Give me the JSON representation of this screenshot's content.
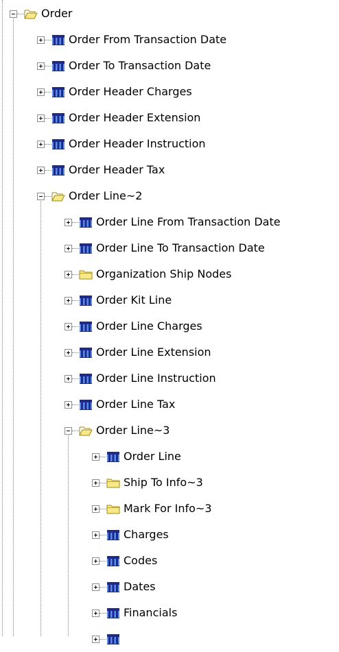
{
  "tree": {
    "root": {
      "label": "Order",
      "icon": "folder-open-icon",
      "expanded": true
    },
    "level1": [
      {
        "label": "Order From Transaction Date",
        "icon": "table-icon",
        "expanded": false
      },
      {
        "label": "Order To Transaction Date",
        "icon": "table-icon",
        "expanded": false
      },
      {
        "label": "Order Header Charges",
        "icon": "table-icon",
        "expanded": false
      },
      {
        "label": "Order Header Extension",
        "icon": "table-icon",
        "expanded": false
      },
      {
        "label": "Order Header Instruction",
        "icon": "table-icon",
        "expanded": false
      },
      {
        "label": "Order Header Tax",
        "icon": "table-icon",
        "expanded": false
      },
      {
        "label": "Order Line~2",
        "icon": "folder-open-icon",
        "expanded": true
      }
    ],
    "level2": [
      {
        "label": "Order Line From Transaction Date",
        "icon": "table-icon",
        "expanded": false
      },
      {
        "label": "Order Line To Transaction Date",
        "icon": "table-icon",
        "expanded": false
      },
      {
        "label": "Organization Ship Nodes",
        "icon": "folder-closed-icon",
        "expanded": false
      },
      {
        "label": "Order Kit Line",
        "icon": "table-icon",
        "expanded": false
      },
      {
        "label": "Order Line Charges",
        "icon": "table-icon",
        "expanded": false
      },
      {
        "label": "Order Line Extension",
        "icon": "table-icon",
        "expanded": false
      },
      {
        "label": "Order Line Instruction",
        "icon": "table-icon",
        "expanded": false
      },
      {
        "label": "Order Line Tax",
        "icon": "table-icon",
        "expanded": false
      },
      {
        "label": "Order Line~3",
        "icon": "folder-open-icon",
        "expanded": true
      }
    ],
    "level3": [
      {
        "label": "Order Line",
        "icon": "table-icon",
        "expanded": false
      },
      {
        "label": "Ship To Info~3",
        "icon": "folder-closed-icon",
        "expanded": false
      },
      {
        "label": "Mark For Info~3",
        "icon": "folder-closed-icon",
        "expanded": false
      },
      {
        "label": "Charges",
        "icon": "table-icon",
        "expanded": false
      },
      {
        "label": "Codes",
        "icon": "table-icon",
        "expanded": false
      },
      {
        "label": "Dates",
        "icon": "table-icon",
        "expanded": false
      },
      {
        "label": "Financials",
        "icon": "table-icon",
        "expanded": false
      },
      {
        "label": "",
        "icon": "table-icon",
        "expanded": false
      }
    ]
  },
  "colors": {
    "folder_fill": "#f7e98a",
    "folder_stroke": "#a08a12",
    "table_dark": "#1c2a8c",
    "table_light": "#5a8ee8",
    "tree_line": "#808080"
  }
}
